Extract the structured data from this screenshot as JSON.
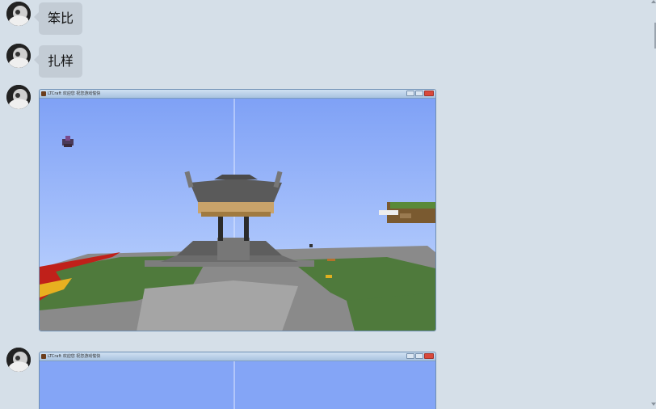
{
  "messages": [
    {
      "type": "text",
      "text": "笨比"
    },
    {
      "type": "text",
      "text": "扎样"
    },
    {
      "type": "image",
      "window_title": "LTCraft 欢迎您 祝您游戏愉快",
      "caption": "Minecraft screenshot: oriental pavilion on a floating island"
    },
    {
      "type": "image",
      "window_title": "LTCraft 欢迎您 祝您游戏愉快",
      "caption": "Minecraft screenshot: sky view (partially visible)"
    }
  ],
  "icons": {
    "avatar": "avatar-icon",
    "scroll_up": "scroll-up-arrow-icon",
    "scroll_down": "scroll-down-arrow-icon",
    "window_close": "close-icon",
    "window_minimize": "minimize-icon",
    "window_maximize": "maximize-icon"
  },
  "colors": {
    "background": "#d5dfe8",
    "bubble": "#c3ccd5",
    "sky": "#8aa9f4"
  }
}
